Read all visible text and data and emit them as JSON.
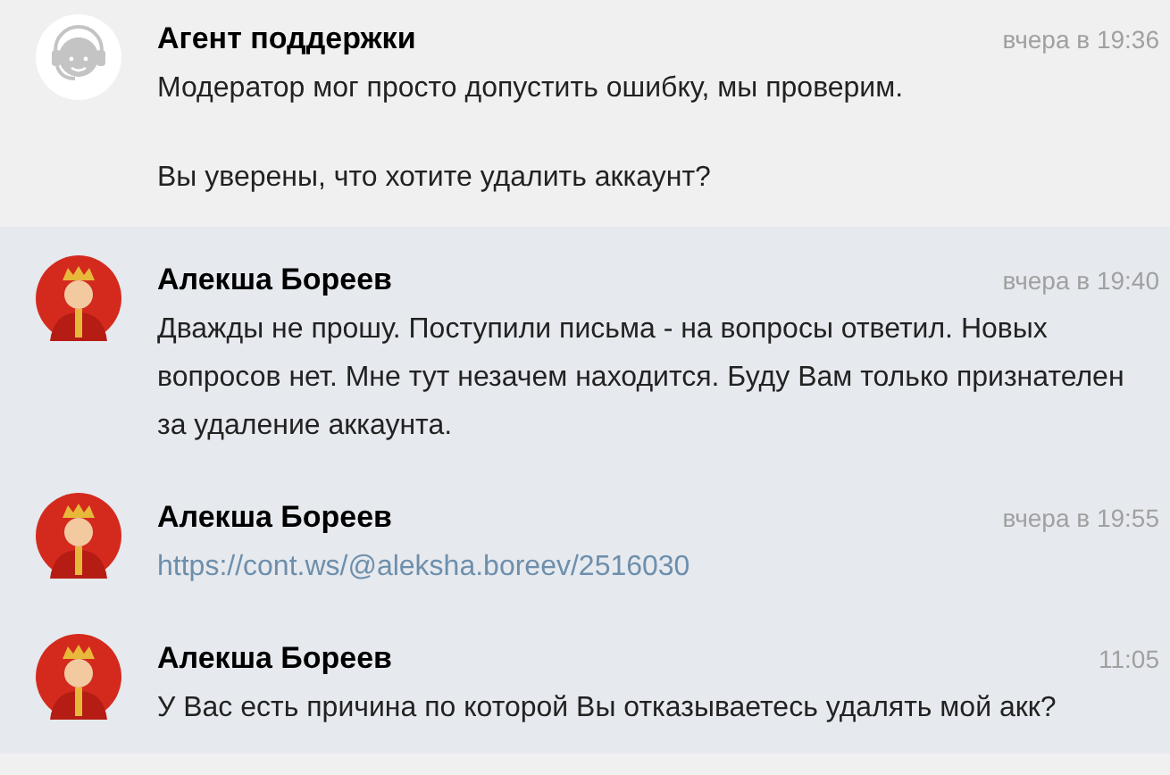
{
  "messages": [
    {
      "kind": "support",
      "author": "Агент поддержки",
      "time": "вчера в 19:36",
      "paragraphs": [
        {
          "kind": "text",
          "text": "Модератор мог просто допустить ошибку, мы проверим."
        },
        {
          "kind": "text",
          "text": "Вы уверены, что хотите удалить аккаунт?"
        }
      ]
    },
    {
      "kind": "user",
      "author": "Алекша Бореев",
      "time": "вчера в 19:40",
      "paragraphs": [
        {
          "kind": "text",
          "text": "Дважды не прошу. Поступили письма - на вопросы ответил. Новых вопросов нет. Мне тут незачем находится. Буду Вам только признателен за удаление аккаунта."
        }
      ]
    },
    {
      "kind": "user",
      "author": "Алекша Бореев",
      "time": "вчера в 19:55",
      "paragraphs": [
        {
          "kind": "link",
          "text": "https://cont.ws/@aleksha.boreev/2516030"
        }
      ]
    },
    {
      "kind": "user",
      "author": "Алекша Бореев",
      "time": "11:05",
      "paragraphs": [
        {
          "kind": "text",
          "text": "У Вас есть причина по которой Вы отказываетесь удалять мой акк?"
        }
      ]
    }
  ]
}
